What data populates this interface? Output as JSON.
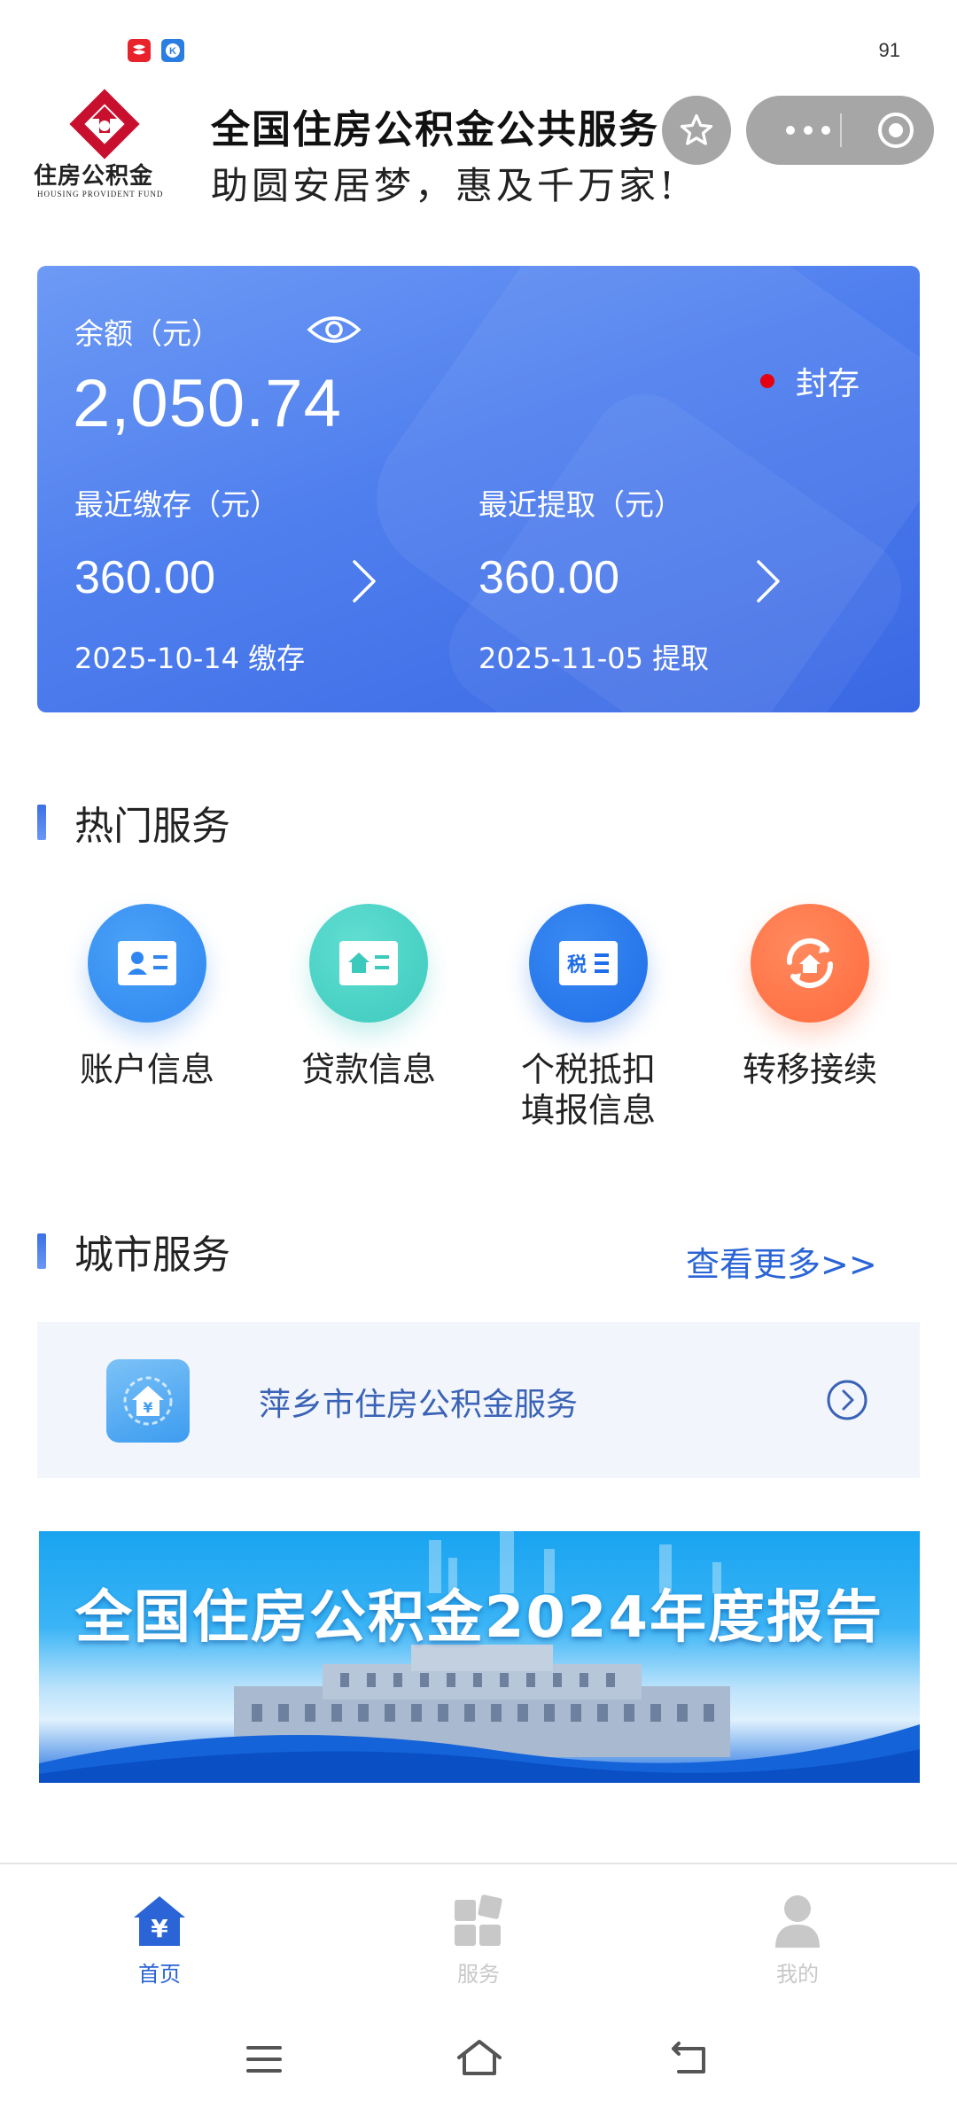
{
  "status_bar": {
    "time": "91"
  },
  "header": {
    "logo_text": "住房公积金",
    "logo_subtext": "HOUSING PROVIDENT FUND",
    "title": "全国住房公积金公共服务",
    "slogan": "助圆安居梦，惠及千万家!"
  },
  "balance_card": {
    "balance_label": "余额（元）",
    "balance_value": "2,050.74",
    "account_status": "封存",
    "recent_deposit": {
      "label": "最近缴存（元）",
      "value": "360.00",
      "date": "2025-10-14 缴存"
    },
    "recent_withdraw": {
      "label": "最近提取（元）",
      "value": "360.00",
      "date": "2025-11-05 提取"
    }
  },
  "hot_services": {
    "title": "热门服务",
    "items": [
      {
        "label": "账户信息",
        "icon": "id-card-icon",
        "color": "#2f86f0"
      },
      {
        "label": "贷款信息",
        "icon": "house-card-icon",
        "color": "#3ccabd"
      },
      {
        "label": "个税抵扣\n填报信息",
        "icon": "tax-icon",
        "color": "#1f6ee8"
      },
      {
        "label": "转移接续",
        "icon": "transfer-icon",
        "color": "#ff6a3d"
      }
    ]
  },
  "city_services": {
    "title": "城市服务",
    "more_link": "查看更多>>",
    "item_label": "萍乡市住房公积金服务"
  },
  "banner": {
    "title": "全国住房公积金2024年度报告"
  },
  "tabbar": {
    "tabs": [
      {
        "label": "首页",
        "active": true
      },
      {
        "label": "服务",
        "active": false
      },
      {
        "label": "我的",
        "active": false
      }
    ]
  },
  "colors": {
    "accent": "#2a64d6",
    "card": "#4f7fee",
    "inactive": "#c8c8c8"
  }
}
